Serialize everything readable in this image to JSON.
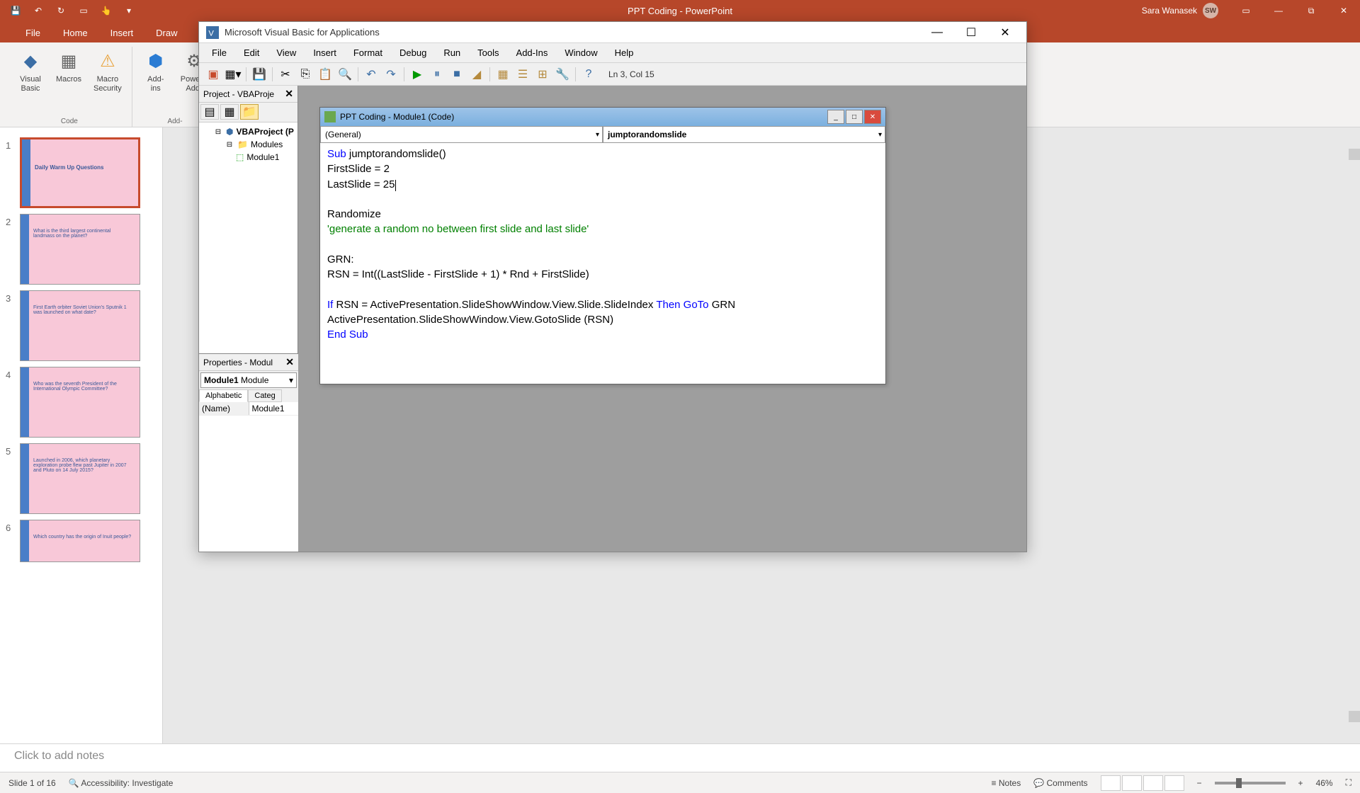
{
  "ppt": {
    "title": "PPT Coding  -  PowerPoint",
    "user": "Sara Wanasek",
    "user_initials": "SW",
    "tabs": [
      "File",
      "Home",
      "Insert",
      "Draw"
    ],
    "ribbon": {
      "group_code": "Code",
      "visual_basic": "Visual\nBasic",
      "macros": "Macros",
      "macro_security": "Macro\nSecurity",
      "addins": "Add-\nins",
      "ppt_addins": "PowerP\nAdd-",
      "addins_group": "Add-"
    },
    "notes_placeholder": "Click to add notes",
    "status": {
      "slide": "Slide 1 of 16",
      "accessibility": "Accessibility: Investigate",
      "notes": "Notes",
      "comments": "Comments",
      "zoom": "46%"
    },
    "thumbs": [
      {
        "n": "1",
        "text": "Daily Warm Up Questions"
      },
      {
        "n": "2",
        "text": "What is the third largest continental landmass on the planet?"
      },
      {
        "n": "3",
        "text": "First Earth orbiter Soviet Union's Sputnik 1 was launched on what date?"
      },
      {
        "n": "4",
        "text": "Who was the seventh President of the International Olympic Committee?"
      },
      {
        "n": "5",
        "text": "Launched in 2006, which planetary exploration probe flew past Jupiter in 2007 and Pluto on 14 July 2015?"
      },
      {
        "n": "6",
        "text": "Which country has the origin of Inuit people?"
      }
    ]
  },
  "vba": {
    "title": "Microsoft Visual Basic for Applications",
    "menus": [
      "File",
      "Edit",
      "View",
      "Insert",
      "Format",
      "Debug",
      "Run",
      "Tools",
      "Add-Ins",
      "Window",
      "Help"
    ],
    "cursor": "Ln 3, Col 15",
    "project_panel_title": "Project - VBAProje",
    "project_root": "VBAProject (P",
    "modules_folder": "Modules",
    "module1": "Module1",
    "props_title": "Properties - Modul",
    "props_combo_name": "Module1",
    "props_combo_type": "Module",
    "props_tab_alpha": "Alphabetic",
    "props_tab_cat": "Categ",
    "props_name_key": "(Name)",
    "props_name_val": "Module1",
    "code_title": "PPT Coding - Module1 (Code)",
    "dd_left": "(General)",
    "dd_right": "jumptorandomslide",
    "code": {
      "l1a": "Sub",
      "l1b": " jumptorandomslide()",
      "l2": "FirstSlide = 2",
      "l3": "LastSlide = 25",
      "l4": "",
      "l5": "Randomize",
      "l6": "'generate a random no between first slide and last slide'",
      "l7": "",
      "l8": "GRN:",
      "l9": "RSN = Int((LastSlide - FirstSlide + 1) * Rnd + FirstSlide)",
      "l10": "",
      "l11a": "If",
      "l11b": " RSN = ActivePresentation.SlideShowWindow.View.Slide.SlideIndex ",
      "l11c": "Then GoTo",
      "l11d": " GRN",
      "l12": "ActivePresentation.SlideShowWindow.View.GotoSlide (RSN)",
      "l13": "End Sub"
    }
  }
}
